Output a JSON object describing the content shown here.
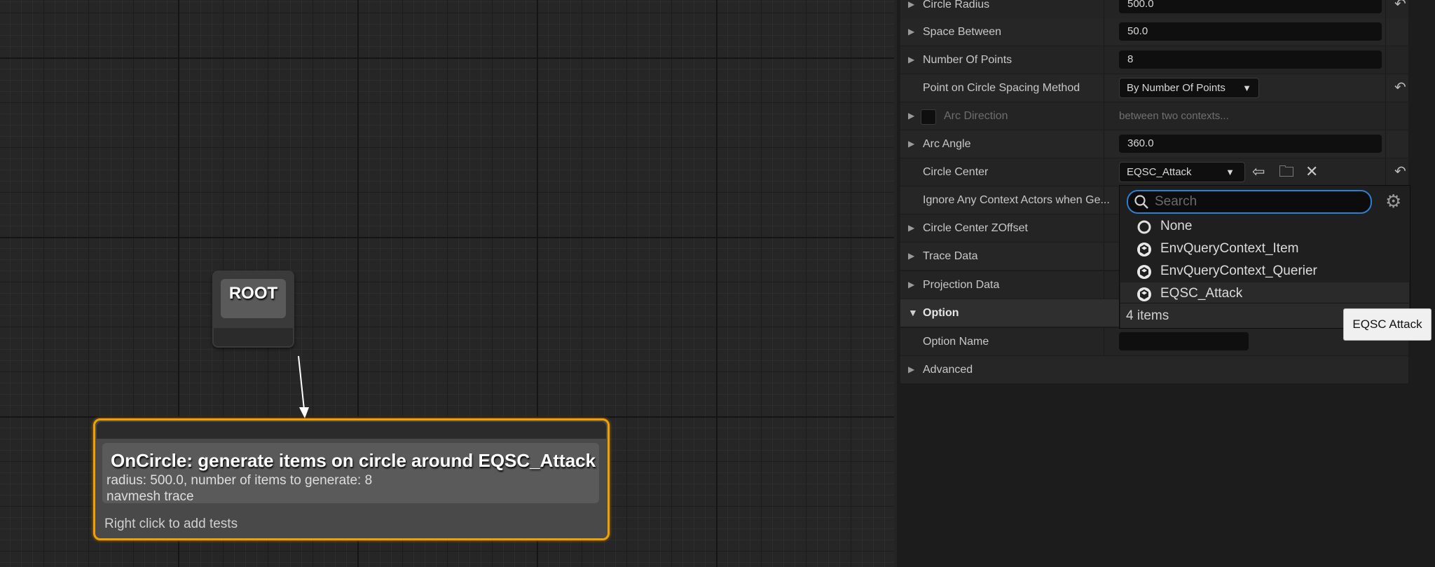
{
  "graph": {
    "root_label": "ROOT",
    "generator": {
      "title": "OnCircle: generate items on circle around EQSC_Attack",
      "desc_line1": "radius: 500.0, number of items to generate: 8",
      "desc_line2": "navmesh trace",
      "hint": "Right click to add tests"
    }
  },
  "details": {
    "rows": {
      "circle_radius": {
        "label": "Circle Radius",
        "value": "500.0"
      },
      "space_between": {
        "label": "Space Between",
        "value": "50.0"
      },
      "number_of_points": {
        "label": "Number Of Points",
        "value": "8"
      },
      "spacing_method": {
        "label": "Point on Circle Spacing Method",
        "value": "By Number Of Points"
      },
      "arc_direction": {
        "label": "Arc Direction",
        "value": "between two contexts..."
      },
      "arc_angle": {
        "label": "Arc Angle",
        "value": "360.0"
      },
      "circle_center": {
        "label": "Circle Center",
        "value": "EQSC_Attack"
      },
      "ignore_context": {
        "label": "Ignore Any Context Actors when Ge..."
      },
      "center_zoffset": {
        "label": "Circle Center ZOffset"
      },
      "trace_data": {
        "label": "Trace Data"
      },
      "projection_data": {
        "label": "Projection Data"
      },
      "option": {
        "label": "Option"
      },
      "option_name": {
        "label": "Option Name",
        "value": ""
      },
      "advanced": {
        "label": "Advanced"
      }
    }
  },
  "dropdown": {
    "search_placeholder": "Search",
    "items": [
      {
        "label": "None",
        "icon": "none-circle-icon"
      },
      {
        "label": "EnvQueryContext_Item",
        "icon": "blueprint-class-icon"
      },
      {
        "label": "EnvQueryContext_Querier",
        "icon": "blueprint-class-icon"
      },
      {
        "label": "EQSC_Attack",
        "icon": "blueprint-class-icon"
      }
    ],
    "count_text": "4 items"
  },
  "tooltip": {
    "text": "EQSC Attack"
  },
  "colors": {
    "accent_selection": "#f0a000",
    "search_focus": "#2f7fd0"
  }
}
